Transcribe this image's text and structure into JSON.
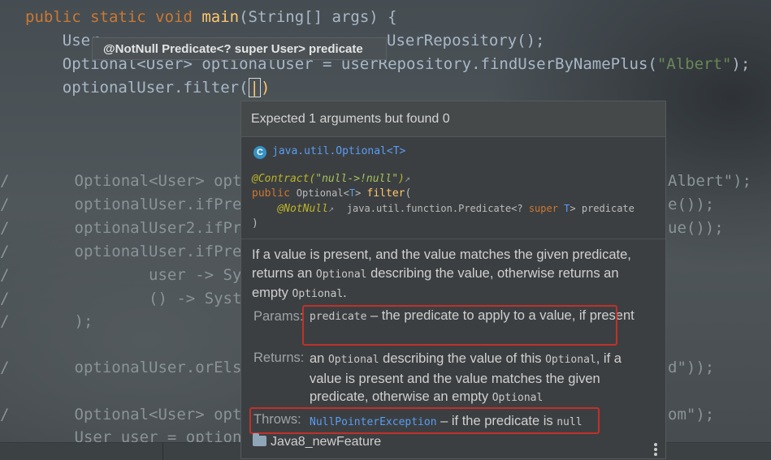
{
  "editor": {
    "line1": {
      "kw": "public static void ",
      "fn": "main",
      "rest": "(String[] args) {"
    },
    "line2": {
      "left": "    User",
      "right": "UserRepository();"
    },
    "line3": {
      "left": "    Optional<User> optionalUser = userRepository.findUserByNamePlus(",
      "str": "\"Albert\"",
      "right": ");"
    },
    "line4": {
      "left": "    optionalUser.filter(",
      "caret": "|",
      "right": ")"
    },
    "line5": {
      "left": "/       Optional<User> opt",
      "right": "Albert\");"
    },
    "line6": {
      "left": "/       optionalUser.ifPre",
      "right": "e());"
    },
    "line7": {
      "left": "/       optionalUser2.ifPr",
      "right": "ue());"
    },
    "line8": {
      "left": "/       optionalUser.ifPre"
    },
    "line9": {
      "left": "/               user -> Sy"
    },
    "line10": {
      "left": "/               () -> Syst"
    },
    "line11": {
      "left": "/       );"
    },
    "line12": {
      "left": "/       optionalUser.orEls",
      "right": "d\"));"
    },
    "line13": {
      "left": "/       Optional<User> opt",
      "right": "om\");"
    },
    "line14": {
      "left": "        User user = option"
    }
  },
  "hint_tooltip": {
    "text": "@NotNull Predicate<? super User> predicate"
  },
  "doc_popup": {
    "error": "Expected 1 arguments but found 0",
    "class_icon": "C",
    "class_name": "java.util.Optional<T>",
    "contract_annotation": "@Contract(",
    "contract_value": "\"null->!null\"",
    "contract_close": ")",
    "sig_public": "public ",
    "sig_type": "Optional",
    "sig_lt": "<",
    "sig_T": "T",
    "sig_gt": "> ",
    "sig_method": "filter",
    "sig_paren": "(",
    "param_annotation": "@NotNull",
    "param_type": "java.util.function.Predicate",
    "param_generic_open": "<? ",
    "param_super": "super",
    "param_T": " T",
    "param_generic_close": "> predicate",
    "sig_close": ")",
    "description": {
      "part1": "If a value is present, and the value matches the given predicate, returns an ",
      "code1": "Optional",
      "part2": " describing the value, otherwise returns an empty ",
      "code2": "Optional",
      "part3": "."
    },
    "params": {
      "label": "Params:",
      "name": "predicate",
      "text": " – the predicate to apply to a value, if present"
    },
    "returns": {
      "label": "Returns:",
      "part1": "an ",
      "code1": "Optional",
      "part2": " describing the value of this ",
      "code2": "Optional",
      "part3": ", if a value is present and the value matches the given predicate, otherwise an empty ",
      "code3": "Optional"
    },
    "throws": {
      "label": "Throws:",
      "exception": "NullPointerException",
      "text": " – if the predicate is ",
      "code": "null"
    },
    "footer_module": "Java8_newFeature"
  },
  "colors": {
    "keyword": "#cc7832",
    "function": "#ffc66d",
    "string": "#6a8759",
    "link": "#589df6",
    "highlight_box": "#c0312b"
  }
}
